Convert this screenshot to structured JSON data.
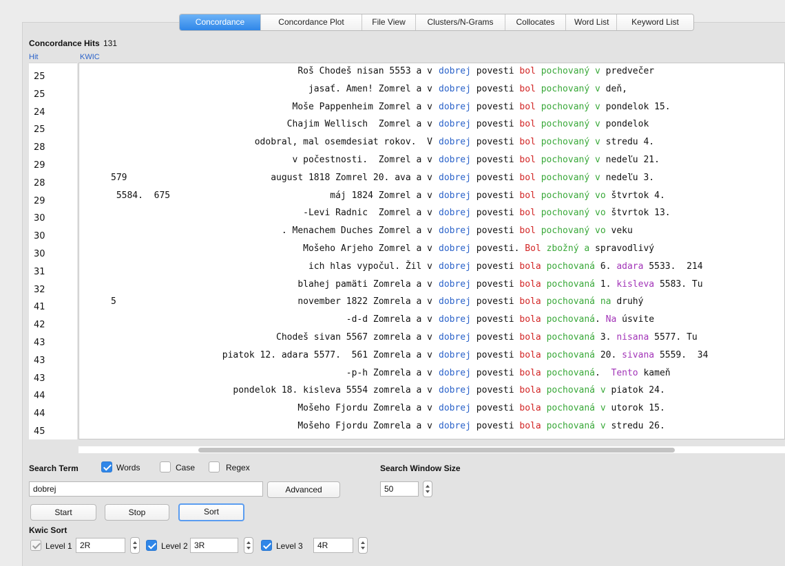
{
  "tabs": [
    "Concordance",
    "Concordance Plot",
    "File View",
    "Clusters/N-Grams",
    "Collocates",
    "Word List",
    "Keyword List"
  ],
  "hits": {
    "label": "Concordance Hits",
    "count": "131"
  },
  "columns": {
    "hit": "Hit",
    "kwic": "KWIC"
  },
  "hit_numbers": [
    "25",
    "25",
    "24",
    "25",
    "28",
    "29",
    "28",
    "29",
    "30",
    "30",
    "30",
    "31",
    "32",
    "41",
    "42",
    "43",
    "43",
    "43",
    "44",
    "44",
    "45"
  ],
  "rows": [
    {
      "left": "Roš Chodeš nisan 5553 a v",
      "right": [
        [
          "k",
          "dobrej"
        ],
        [
          "n",
          " povesti "
        ],
        [
          "r",
          "bol"
        ],
        [
          "n",
          " "
        ],
        [
          "g",
          "pochovaný"
        ],
        [
          "n",
          " "
        ],
        [
          "g",
          "v"
        ],
        [
          "n",
          " predvečer"
        ]
      ]
    },
    {
      "left": "jasať. Amen! Zomrel a v",
      "right": [
        [
          "k",
          "dobrej"
        ],
        [
          "n",
          " povesti "
        ],
        [
          "r",
          "bol"
        ],
        [
          "n",
          " "
        ],
        [
          "g",
          "pochovaný"
        ],
        [
          "n",
          " "
        ],
        [
          "g",
          "v"
        ],
        [
          "n",
          " deň,"
        ]
      ]
    },
    {
      "left": "Moše Pappenheim Zomrel a v",
      "right": [
        [
          "k",
          "dobrej"
        ],
        [
          "n",
          " povesti "
        ],
        [
          "r",
          "bol"
        ],
        [
          "n",
          " "
        ],
        [
          "g",
          "pochovaný"
        ],
        [
          "n",
          " "
        ],
        [
          "g",
          "v"
        ],
        [
          "n",
          " pondelok 15."
        ]
      ]
    },
    {
      "left": "Chajim Wellisch  Zomrel a v",
      "right": [
        [
          "k",
          "dobrej"
        ],
        [
          "n",
          " povesti "
        ],
        [
          "r",
          "bol"
        ],
        [
          "n",
          " "
        ],
        [
          "g",
          "pochovaný"
        ],
        [
          "n",
          " "
        ],
        [
          "g",
          "v"
        ],
        [
          "n",
          " pondelok"
        ]
      ]
    },
    {
      "left": "odobral, mal osemdesiat rokov.  V",
      "right": [
        [
          "k",
          "dobrej"
        ],
        [
          "n",
          " povesti "
        ],
        [
          "r",
          "bol"
        ],
        [
          "n",
          " "
        ],
        [
          "g",
          "pochovaný"
        ],
        [
          "n",
          " "
        ],
        [
          "g",
          "v"
        ],
        [
          "n",
          " stredu 4."
        ]
      ]
    },
    {
      "left": "v počestnosti.  Zomrel a v",
      "right": [
        [
          "k",
          "dobrej"
        ],
        [
          "n",
          " povesti "
        ],
        [
          "r",
          "bol"
        ],
        [
          "n",
          " "
        ],
        [
          "g",
          "pochovaný"
        ],
        [
          "n",
          " "
        ],
        [
          "g",
          "v"
        ],
        [
          "n",
          " nedeľu 21."
        ]
      ]
    },
    {
      "pre": "579",
      "left": "august 1818 Zomrel 20. ava a v",
      "right": [
        [
          "k",
          "dobrej"
        ],
        [
          "n",
          " povesti "
        ],
        [
          "r",
          "bol"
        ],
        [
          "n",
          " "
        ],
        [
          "g",
          "pochovaný"
        ],
        [
          "n",
          " "
        ],
        [
          "g",
          "v"
        ],
        [
          "n",
          " nedeľu 3."
        ]
      ]
    },
    {
      "pre": " 5584.  675",
      "left": "máj 1824 Zomrel a v",
      "right": [
        [
          "k",
          "dobrej"
        ],
        [
          "n",
          " povesti "
        ],
        [
          "r",
          "bol"
        ],
        [
          "n",
          " "
        ],
        [
          "g",
          "pochovaný"
        ],
        [
          "n",
          " "
        ],
        [
          "g",
          "vo"
        ],
        [
          "n",
          " štvrtok 4."
        ]
      ]
    },
    {
      "left": "-Levi Radnic  Zomrel a v",
      "right": [
        [
          "k",
          "dobrej"
        ],
        [
          "n",
          " povesti "
        ],
        [
          "r",
          "bol"
        ],
        [
          "n",
          " "
        ],
        [
          "g",
          "pochovaný"
        ],
        [
          "n",
          " "
        ],
        [
          "g",
          "vo"
        ],
        [
          "n",
          " štvrtok 13."
        ]
      ]
    },
    {
      "left": ". Menachem Duches Zomrel a v",
      "right": [
        [
          "k",
          "dobrej"
        ],
        [
          "n",
          " povesti "
        ],
        [
          "r",
          "bol"
        ],
        [
          "n",
          " "
        ],
        [
          "g",
          "pochovaný"
        ],
        [
          "n",
          " "
        ],
        [
          "g",
          "vo"
        ],
        [
          "n",
          " veku"
        ]
      ]
    },
    {
      "left": "Mošeho Arjeho Zomrel a v",
      "right": [
        [
          "k",
          "dobrej"
        ],
        [
          "n",
          " povesti. "
        ],
        [
          "r",
          "Bol"
        ],
        [
          "n",
          " "
        ],
        [
          "g",
          "zbožný"
        ],
        [
          "n",
          " "
        ],
        [
          "g",
          "a"
        ],
        [
          "n",
          " spravodlivý"
        ]
      ]
    },
    {
      "left": "ich hlas vypočul. Žil v",
      "right": [
        [
          "k",
          "dobrej"
        ],
        [
          "n",
          " povesti "
        ],
        [
          "r",
          "bola"
        ],
        [
          "n",
          " "
        ],
        [
          "g",
          "pochovaná"
        ],
        [
          "n",
          " 6. "
        ],
        [
          "p",
          "adara"
        ],
        [
          "n",
          " 5533.  214"
        ]
      ]
    },
    {
      "left": "blahej pamäti Zomrela a v",
      "right": [
        [
          "k",
          "dobrej"
        ],
        [
          "n",
          " povesti "
        ],
        [
          "r",
          "bola"
        ],
        [
          "n",
          " "
        ],
        [
          "g",
          "pochovaná"
        ],
        [
          "n",
          " 1. "
        ],
        [
          "p",
          "kisleva"
        ],
        [
          "n",
          " 5583. Tu"
        ]
      ]
    },
    {
      "pre": "5",
      "left": "november 1822 Zomrela a v",
      "right": [
        [
          "k",
          "dobrej"
        ],
        [
          "n",
          " povesti "
        ],
        [
          "r",
          "bola"
        ],
        [
          "n",
          " "
        ],
        [
          "g",
          "pochovaná"
        ],
        [
          "n",
          " "
        ],
        [
          "g",
          "na"
        ],
        [
          "n",
          " druhý"
        ]
      ]
    },
    {
      "left": "-d-d Zomrela a v",
      "right": [
        [
          "k",
          "dobrej"
        ],
        [
          "n",
          " povesti "
        ],
        [
          "r",
          "bola"
        ],
        [
          "n",
          " "
        ],
        [
          "g",
          "pochovaná"
        ],
        [
          "n",
          ". "
        ],
        [
          "p",
          "Na"
        ],
        [
          "n",
          " úsvite"
        ]
      ]
    },
    {
      "left": "Chodeš sivan 5567 zomrela a v",
      "right": [
        [
          "k",
          "dobrej"
        ],
        [
          "n",
          " povesti "
        ],
        [
          "r",
          "bola"
        ],
        [
          "n",
          " "
        ],
        [
          "g",
          "pochovaná"
        ],
        [
          "n",
          " 3. "
        ],
        [
          "p",
          "nisana"
        ],
        [
          "n",
          " 5577. Tu"
        ]
      ]
    },
    {
      "left": "piatok 12. adara 5577.  561 Zomrela a v",
      "right": [
        [
          "k",
          "dobrej"
        ],
        [
          "n",
          " povesti "
        ],
        [
          "r",
          "bola"
        ],
        [
          "n",
          " "
        ],
        [
          "g",
          "pochovaná"
        ],
        [
          "n",
          " 20. "
        ],
        [
          "p",
          "sivana"
        ],
        [
          "n",
          " 5559.  34"
        ]
      ]
    },
    {
      "left": "-p-h Zomrela a v",
      "right": [
        [
          "k",
          "dobrej"
        ],
        [
          "n",
          " povesti "
        ],
        [
          "r",
          "bola"
        ],
        [
          "n",
          " "
        ],
        [
          "g",
          "pochovaná"
        ],
        [
          "n",
          ".  "
        ],
        [
          "p",
          "Tento"
        ],
        [
          "n",
          " kameň"
        ]
      ]
    },
    {
      "left": "pondelok 18. kisleva 5554 zomrela a v",
      "right": [
        [
          "k",
          "dobrej"
        ],
        [
          "n",
          " povesti "
        ],
        [
          "r",
          "bola"
        ],
        [
          "n",
          " "
        ],
        [
          "g",
          "pochovaná"
        ],
        [
          "n",
          " "
        ],
        [
          "g",
          "v"
        ],
        [
          "n",
          " piatok 24."
        ]
      ]
    },
    {
      "left": "Mošeho Fjordu Zomrela a v",
      "right": [
        [
          "k",
          "dobrej"
        ],
        [
          "n",
          " povesti "
        ],
        [
          "r",
          "bola"
        ],
        [
          "n",
          " "
        ],
        [
          "g",
          "pochovaná"
        ],
        [
          "n",
          " "
        ],
        [
          "g",
          "v"
        ],
        [
          "n",
          " utorok 15."
        ]
      ]
    },
    {
      "left": "Mošeho Fjordu Zomrela a v",
      "right": [
        [
          "k",
          "dobrej"
        ],
        [
          "n",
          " povesti "
        ],
        [
          "r",
          "bola"
        ],
        [
          "n",
          " "
        ],
        [
          "g",
          "pochovaná"
        ],
        [
          "n",
          " "
        ],
        [
          "g",
          "v"
        ],
        [
          "n",
          " stredu 26."
        ]
      ]
    }
  ],
  "search": {
    "label": "Search Term",
    "words_label": "Words",
    "case_label": "Case",
    "regex_label": "Regex",
    "value": "dobrej",
    "advanced_label": "Advanced",
    "window_label": "Search Window Size",
    "window_value": "50"
  },
  "buttons": {
    "start": "Start",
    "stop": "Stop",
    "sort": "Sort"
  },
  "kwic_sort": {
    "label": "Kwic Sort",
    "level1_label": "Level 1",
    "level1_value": "2R",
    "level2_label": "Level 2",
    "level2_value": "3R",
    "level3_label": "Level 3",
    "level3_value": "4R"
  }
}
